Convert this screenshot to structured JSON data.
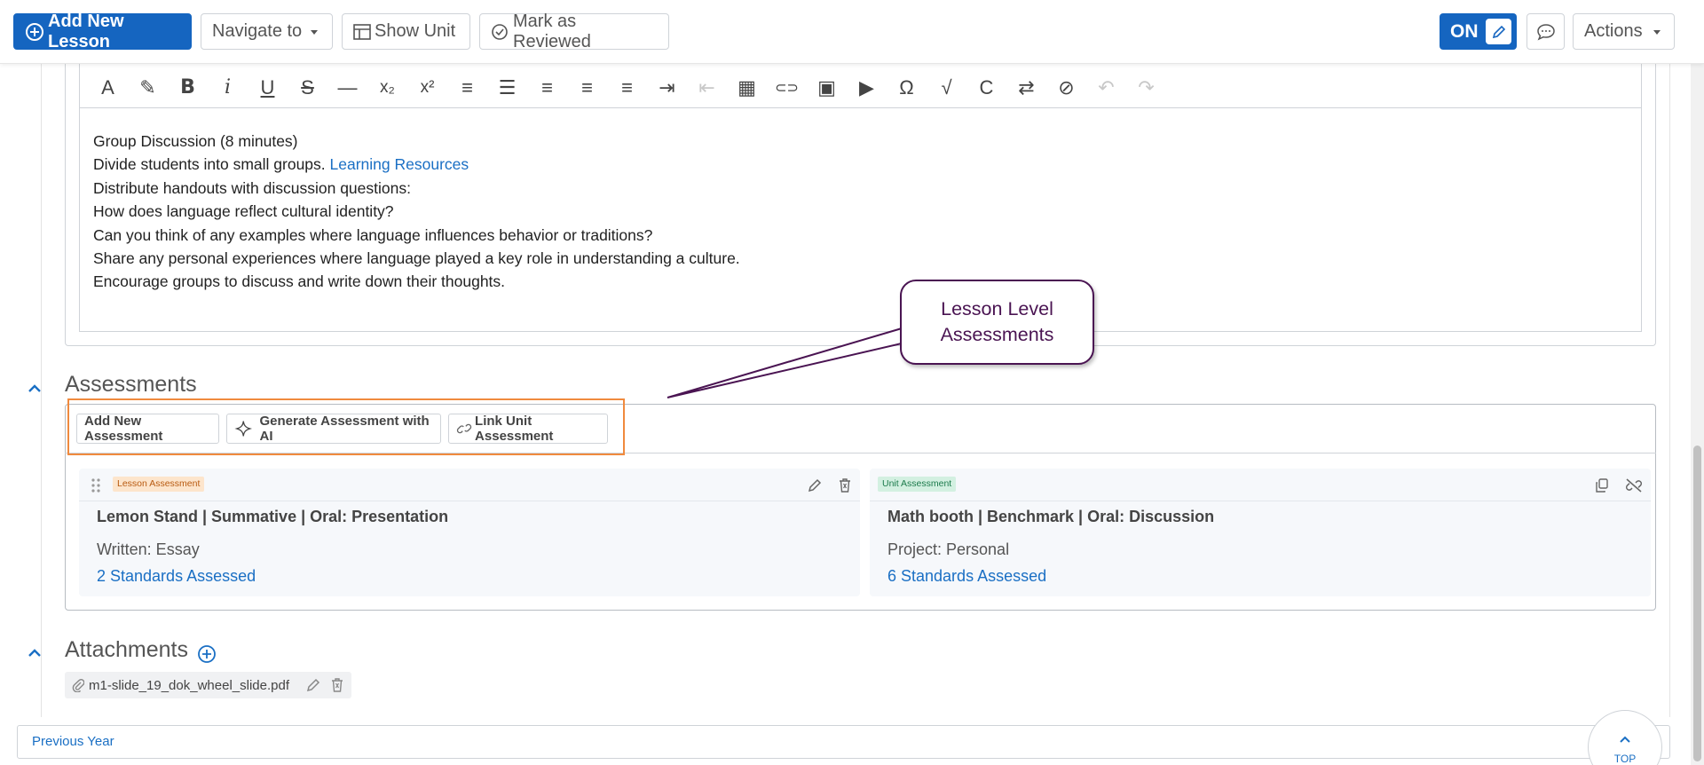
{
  "toolbar": {
    "add_lesson": "Add New Lesson",
    "navigate": "Navigate to",
    "show_unit": "Show Unit",
    "mark_reviewed": "Mark as Reviewed",
    "toggle": "ON",
    "actions": "Actions"
  },
  "editor": {
    "lines": [
      "Group Discussion (8 minutes)",
      "Divide students into small groups. ",
      "Distribute handouts with discussion questions:",
      "How does language reflect cultural identity?",
      "Can you think of any examples where language influences behavior or traditions?",
      "Share any personal experiences where language played a key role in understanding a culture.",
      "Encourage groups to discuss and write down their thoughts."
    ],
    "link": "Learning Resources",
    "tools": [
      "text-color",
      "highlight",
      "bold",
      "italic",
      "underline",
      "strikethrough",
      "horizontal-rule",
      "subscript",
      "superscript",
      "ordered-list",
      "bullet-list",
      "align-left",
      "align-center",
      "align-right",
      "indent",
      "outdent",
      "table",
      "link",
      "image",
      "video",
      "special-char",
      "equation",
      "clear-format",
      "ltr-rtl",
      "remove-format",
      "undo",
      "redo"
    ]
  },
  "callout": {
    "line1": "Lesson Level",
    "line2": "Assessments"
  },
  "assessments": {
    "title": "Assessments",
    "add_new": "Add New Assessment",
    "generate_ai": "Generate Assessment with AI",
    "link_unit": "Link Unit Assessment",
    "cards": [
      {
        "badge": "Lesson Assessment",
        "title": "Lemon Stand | Summative | Oral: Presentation",
        "type": "Written: Essay",
        "standards": "2 Standards Assessed"
      },
      {
        "badge": "Unit Assessment",
        "title": "Math booth | Benchmark | Oral: Discussion",
        "type": "Project: Personal",
        "standards": "6 Standards Assessed"
      }
    ]
  },
  "attachments": {
    "title": "Attachments",
    "file": "m1-slide_19_dok_wheel_slide.pdf"
  },
  "footer": {
    "previous": "Previous Year",
    "top": "TOP"
  },
  "colors": {
    "primary": "#1565c0",
    "link": "#1a6fc4",
    "callout": "#4a1452",
    "highlight": "#f08a3e"
  }
}
